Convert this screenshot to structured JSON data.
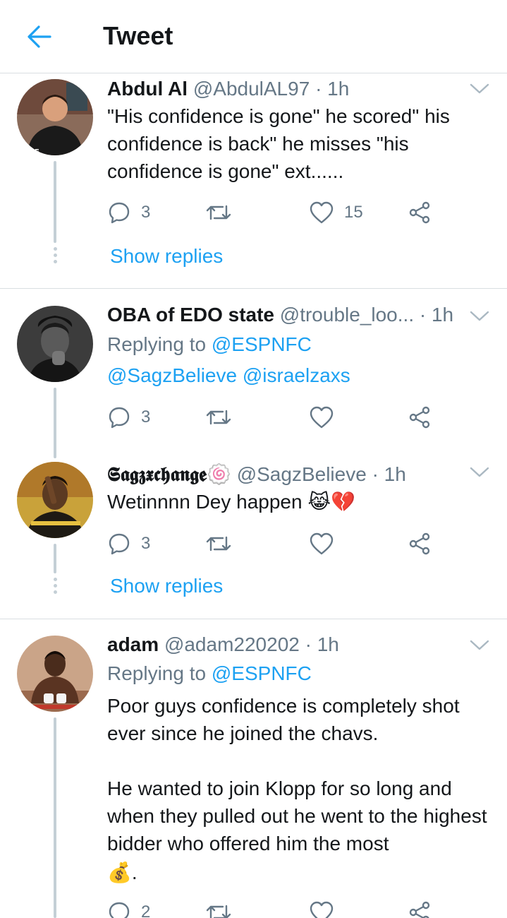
{
  "header": {
    "title": "Tweet"
  },
  "tweets": [
    {
      "name": "Abdul Al",
      "handle": "@AbdulAL97",
      "time": "· 1h",
      "text": "\"His confidence is gone\" he scored\" his confidence is back\" he misses \"his confidence is gone\" ext......",
      "replies": "3",
      "retweets": "",
      "likes": "15",
      "show_replies": "Show replies"
    },
    {
      "name": "OBA of EDO state",
      "handle": "@trouble_loo...",
      "time": "· 1h",
      "replying_label": "Replying to",
      "replying_to": [
        "@ESPNFC",
        "@SagzBelieve",
        "@israelzaxs"
      ],
      "replies": "3",
      "retweets": "",
      "likes": ""
    },
    {
      "name": "𝕾𝖆𝖌𝖟𝖝𝖈𝖍𝖆𝖓𝖌𝖊",
      "name_emoji": "🍥",
      "handle": "@SagzBelieve",
      "time": "· 1h",
      "text": "Wetinnnn Dey happen",
      "text_emoji": "😹💔",
      "replies": "3",
      "retweets": "",
      "likes": "",
      "show_replies": "Show replies"
    },
    {
      "name": "adam",
      "handle": "@adam220202",
      "time": "· 1h",
      "replying_label": "Replying to",
      "replying_to": [
        "@ESPNFC"
      ],
      "text_para1": "Poor guys confidence is completely shot ever since he joined the chavs.",
      "text_para2": "He wanted to join Klopp for so long and when they pulled out he went to the highest bidder who offered him the most",
      "text_emoji": "💰.",
      "replies": "2",
      "retweets": "",
      "likes": ""
    }
  ],
  "colors": {
    "accent": "#1da1f2",
    "secondary_text": "#657786",
    "divider": "#d9dee2"
  },
  "icons": [
    "back-arrow-icon",
    "chevron-down-icon",
    "reply-icon",
    "retweet-icon",
    "like-icon",
    "share-icon"
  ]
}
